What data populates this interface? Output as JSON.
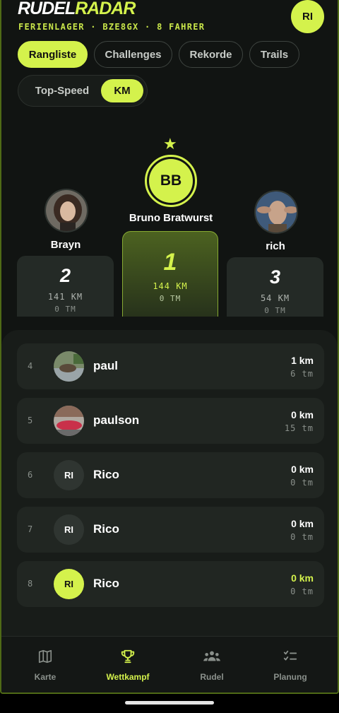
{
  "app": {
    "brand_part1": "RUDEL",
    "brand_part2": "RADAR",
    "subtitle": "FERIENLAGER · BZE8GX · 8 FAHRER",
    "user_initials": "RI"
  },
  "tabs": [
    {
      "label": "Rangliste",
      "active": true
    },
    {
      "label": "Challenges",
      "active": false
    },
    {
      "label": "Rekorde",
      "active": false
    },
    {
      "label": "Trails",
      "active": false
    }
  ],
  "toggle": [
    {
      "label": "Top-Speed",
      "active": false
    },
    {
      "label": "KM",
      "active": true
    }
  ],
  "podium": {
    "first": {
      "rank": "1",
      "name": "Bruno Bratwurst",
      "initials": "BB",
      "km": "144 KM",
      "tm": "0 TM"
    },
    "second": {
      "rank": "2",
      "name": "Brayn",
      "km": "141 KM",
      "tm": "0 TM"
    },
    "third": {
      "rank": "3",
      "name": "rich",
      "km": "54 KM",
      "tm": "0 TM"
    }
  },
  "ranking": [
    {
      "idx": "4",
      "name": "paul",
      "km": "1 km",
      "tm": "6 tm",
      "avatar": "photo"
    },
    {
      "idx": "5",
      "name": "paulson",
      "km": "0 km",
      "tm": "15 tm",
      "avatar": "photo"
    },
    {
      "idx": "6",
      "name": "Rico",
      "km": "0 km",
      "tm": "0 tm",
      "avatar": "RI"
    },
    {
      "idx": "7",
      "name": "Rico",
      "km": "0 km",
      "tm": "0 tm",
      "avatar": "RI"
    },
    {
      "idx": "8",
      "name": "Rico",
      "km": "0 km",
      "tm": "0 tm",
      "avatar": "RI",
      "highlight": true
    }
  ],
  "nav": [
    {
      "label": "Karte",
      "icon": "map-icon",
      "active": false
    },
    {
      "label": "Wettkampf",
      "icon": "trophy-icon",
      "active": true
    },
    {
      "label": "Rudel",
      "icon": "group-icon",
      "active": false
    },
    {
      "label": "Planung",
      "icon": "checklist-icon",
      "active": false
    }
  ],
  "colors": {
    "accent": "#d4f24c",
    "background": "#111412",
    "card": "#212622"
  }
}
